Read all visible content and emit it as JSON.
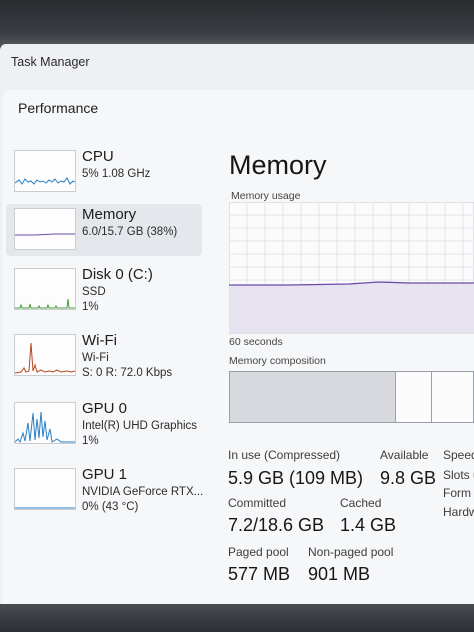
{
  "app": {
    "title": "Task Manager"
  },
  "page": {
    "section": "Performance"
  },
  "sidebar": {
    "items": [
      {
        "name": "CPU",
        "line1": "5% 1.08 GHz",
        "line2": ""
      },
      {
        "name": "Memory",
        "line1": "6.0/15.7 GB (38%)",
        "line2": ""
      },
      {
        "name": "Disk 0 (C:)",
        "line1": "SSD",
        "line2": "1%"
      },
      {
        "name": "Wi-Fi",
        "line1": "Wi-Fi",
        "line2": "S: 0 R: 72.0 Kbps"
      },
      {
        "name": "GPU 0",
        "line1": "Intel(R) UHD Graphics",
        "line2": "1%"
      },
      {
        "name": "GPU 1",
        "line1": "NVIDIA GeForce RTX...",
        "line2": "0% (43 °C)"
      }
    ]
  },
  "main": {
    "title": "Memory",
    "usage_label": "Memory usage",
    "time_label": "60 seconds",
    "composition_label": "Memory composition",
    "stats": {
      "in_use_label": "In use (Compressed)",
      "in_use_value": "5.9 GB (109 MB)",
      "available_label": "Available",
      "available_value": "9.8 GB",
      "committed_label": "Committed",
      "committed_value": "7.2/18.6 GB",
      "cached_label": "Cached",
      "cached_value": "1.4 GB",
      "paged_label": "Paged pool",
      "paged_value": "577 MB",
      "nonpaged_label": "Non-paged pool",
      "nonpaged_value": "901 MB"
    },
    "side_labels": [
      "Speed",
      "Slots u",
      "Form f",
      "Hardw"
    ]
  },
  "colors": {
    "memory_accent": "#6a4aa5",
    "cpu_accent": "#2a7fc4",
    "disk_accent": "#4b9a3a",
    "wifi_accent": "#b2481f",
    "gpu_accent": "#2a7fc4"
  }
}
